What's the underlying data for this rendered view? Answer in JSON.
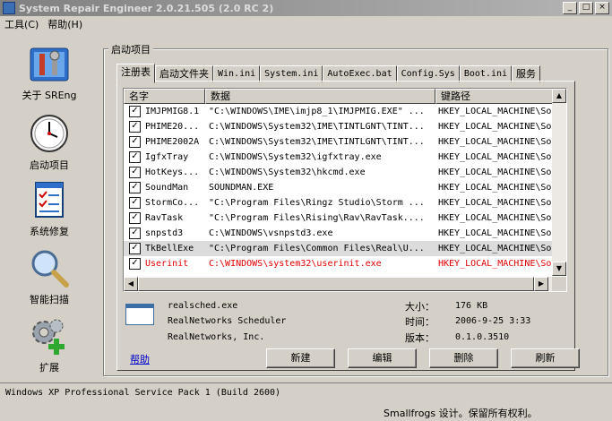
{
  "window": {
    "title": "System Repair Engineer 2.0.21.505 (2.0 RC 2)",
    "minimize": "_",
    "maximize": "□",
    "close": "×"
  },
  "menu": [
    "工具(C)",
    "帮助(H)"
  ],
  "sidebar": [
    {
      "label": "关于 SREng",
      "icon": "toolbox-icon"
    },
    {
      "label": "启动项目",
      "icon": "clock-icon"
    },
    {
      "label": "系统修复",
      "icon": "checklist-icon"
    },
    {
      "label": "智能扫描",
      "icon": "magnifier-icon"
    },
    {
      "label": "扩展",
      "icon": "gears-plus-icon"
    }
  ],
  "group_title": "启动项目",
  "tabs": [
    "注册表",
    "启动文件夹",
    "Win.ini",
    "System.ini",
    "AutoExec.bat",
    "Config.Sys",
    "Boot.ini",
    "服务"
  ],
  "columns": [
    "名字",
    "数据",
    "键路径"
  ],
  "rows": [
    {
      "name": "IMJPMIG8.1",
      "data": "\"C:\\WINDOWS\\IME\\imjp8_1\\IMJPMIG.EXE\" ...",
      "key": "HKEY_LOCAL_MACHINE\\Softw",
      "checked": true
    },
    {
      "name": "PHIME20...",
      "data": "C:\\WINDOWS\\System32\\IME\\TINTLGNT\\TINT...",
      "key": "HKEY_LOCAL_MACHINE\\Softw",
      "checked": true
    },
    {
      "name": "PHIME2002A",
      "data": "C:\\WINDOWS\\System32\\IME\\TINTLGNT\\TINT...",
      "key": "HKEY_LOCAL_MACHINE\\Softw",
      "checked": true
    },
    {
      "name": "IgfxTray",
      "data": "C:\\WINDOWS\\System32\\igfxtray.exe",
      "key": "HKEY_LOCAL_MACHINE\\Softw",
      "checked": true
    },
    {
      "name": "HotKeys...",
      "data": "C:\\WINDOWS\\System32\\hkcmd.exe",
      "key": "HKEY_LOCAL_MACHINE\\Softw",
      "checked": true
    },
    {
      "name": "SoundMan",
      "data": "SOUNDMAN.EXE",
      "key": "HKEY_LOCAL_MACHINE\\Softw",
      "checked": true
    },
    {
      "name": "StormCo...",
      "data": "\"C:\\Program Files\\Ringz Studio\\Storm ...",
      "key": "HKEY_LOCAL_MACHINE\\Softw",
      "checked": true
    },
    {
      "name": "RavTask",
      "data": "\"C:\\Program Files\\Rising\\Rav\\RavTask....",
      "key": "HKEY_LOCAL_MACHINE\\Softw",
      "checked": true
    },
    {
      "name": "snpstd3",
      "data": "C:\\WINDOWS\\vsnpstd3.exe",
      "key": "HKEY_LOCAL_MACHINE\\Softw",
      "checked": true
    },
    {
      "name": "TkBellExe",
      "data": "\"C:\\Program Files\\Common Files\\Real\\U...",
      "key": "HKEY_LOCAL_MACHINE\\Softw",
      "checked": true
    },
    {
      "name": "Userinit",
      "data": "C:\\WINDOWS\\system32\\userinit.exe",
      "key": "HKEY_LOCAL_MACHINE\\Softw",
      "checked": true
    }
  ],
  "selected_row": 9,
  "highlight_row": 10,
  "highlight_color": "#e00000",
  "details": {
    "file": "realsched.exe",
    "description": "RealNetworks Scheduler",
    "company": "RealNetworks, Inc.",
    "size_label": "大小：",
    "size_value": "176 KB",
    "time_label": "时间：",
    "time_value": "2006-9-25 3:33",
    "version_label": "版本：",
    "version_value": "0.1.0.3510"
  },
  "buttons": {
    "help": "帮助",
    "new": "新建",
    "edit": "编辑",
    "delete": "删除",
    "refresh": "刷新"
  },
  "status": {
    "os": "Windows XP Professional Service Pack 1 (Build 2600)",
    "credit": "Smallfrogs 设计。保留所有权利。"
  }
}
